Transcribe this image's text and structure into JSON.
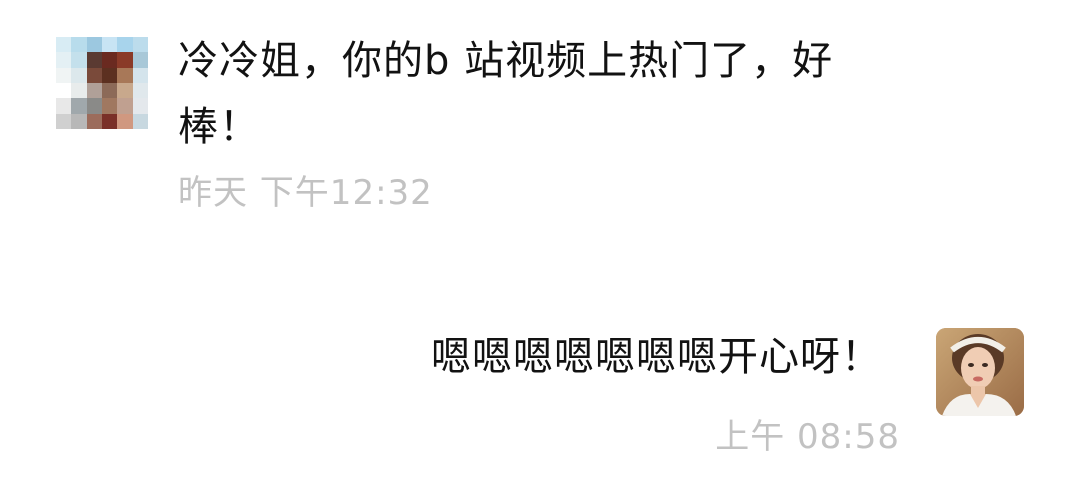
{
  "incoming": {
    "text": "冷冷姐，你的b 站视频上热门了，好棒！",
    "time": "昨天 下午12:32",
    "avatar_pixels": [
      "#d8ecf4",
      "#b8dcec",
      "#9cc8e0",
      "#c8e4f4",
      "#a8d4ec",
      "#bcdcec",
      "#e4f0f4",
      "#c4e0ec",
      "#5a3a32",
      "#6a2a20",
      "#8a3a28",
      "#a8c8d8",
      "#f0f4f4",
      "#dce8ec",
      "#7a4a3a",
      "#5c3020",
      "#a87858",
      "#d4e4ec",
      "#ffffff",
      "#e8ecec",
      "#b0a098",
      "#8c6a58",
      "#c8a88c",
      "#e0e8ec",
      "#e8e8e8",
      "#a0a8ac",
      "#8a8a88",
      "#a07860",
      "#c0a090",
      "#e4e8ec",
      "#d0d0d0",
      "#b8b8b8",
      "#9c6c5c",
      "#7a3028",
      "#d09880",
      "#c8d8e0"
    ]
  },
  "outgoing": {
    "text": "嗯嗯嗯嗯嗯嗯嗯开心呀！",
    "time": "上午 08:58"
  },
  "colors": {
    "text": "#121212",
    "timestamp": "#c2c2c2",
    "background": "#ffffff"
  }
}
